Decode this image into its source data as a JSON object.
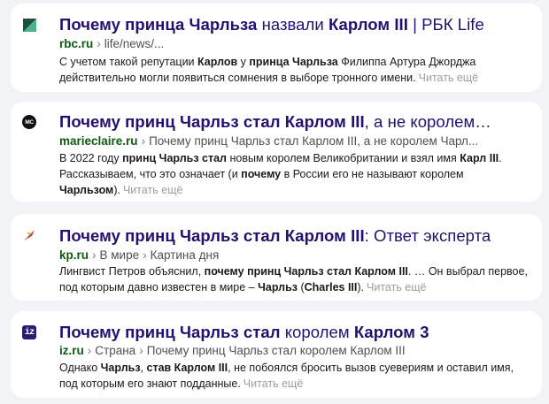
{
  "results": [
    {
      "favicon": "rbc-favicon-icon",
      "title_parts": [
        {
          "text": "Почему принца Чарльза",
          "bold": true
        },
        {
          "text": " назвали ",
          "bold": false
        },
        {
          "text": "Карлом III",
          "bold": true
        },
        {
          "text": " | РБК Life",
          "bold": false
        }
      ],
      "host": "rbc.ru",
      "crumbs": [
        "life/news/..."
      ],
      "snippet_parts": [
        {
          "text": "С учетом такой репутации ",
          "bold": false
        },
        {
          "text": "Карлов",
          "bold": true
        },
        {
          "text": " у ",
          "bold": false
        },
        {
          "text": "принца Чарльза",
          "bold": true
        },
        {
          "text": " Филиппа Артура Джорджа действительно могли появиться сомнения в выборе тронного имени.",
          "bold": false
        }
      ],
      "read_more": "Читать ещё"
    },
    {
      "favicon": "marieclaire-favicon-icon",
      "favicon_text": "MC",
      "title_parts": [
        {
          "text": "Почему принц Чарльз стал Карлом III",
          "bold": true
        },
        {
          "text": ", а не королем…",
          "bold": false
        }
      ],
      "host": "marieclaire.ru",
      "crumbs": [
        "Почему принц Чарльз стал Карлом III, а не королем Чарл..."
      ],
      "snippet_parts": [
        {
          "text": "В 2022 году ",
          "bold": false
        },
        {
          "text": "принц Чарльз стал",
          "bold": true
        },
        {
          "text": " новым королем Великобритании и взял имя ",
          "bold": false
        },
        {
          "text": "Карл III",
          "bold": true
        },
        {
          "text": ". Рассказываем, что это означает (и ",
          "bold": false
        },
        {
          "text": "почему",
          "bold": true
        },
        {
          "text": " в России его не называют королем ",
          "bold": false
        },
        {
          "text": "Чарльзом",
          "bold": true
        },
        {
          "text": ").",
          "bold": false
        }
      ],
      "read_more": "Читать ещё"
    },
    {
      "favicon": "kp-favicon-icon",
      "title_parts": [
        {
          "text": "Почему принц Чарльз стал Карлом III",
          "bold": true
        },
        {
          "text": ": Ответ эксперта",
          "bold": false
        }
      ],
      "host": "kp.ru",
      "crumbs": [
        "В мире",
        "Картина дня"
      ],
      "snippet_parts": [
        {
          "text": "Лингвист Петров объяснил, ",
          "bold": false
        },
        {
          "text": "почему принц Чарльз стал Карлом III",
          "bold": true
        },
        {
          "text": ". … Он выбрал первое, под которым давно известен в мире – ",
          "bold": false
        },
        {
          "text": "Чарльз",
          "bold": true
        },
        {
          "text": " (",
          "bold": false
        },
        {
          "text": "Charles III",
          "bold": true
        },
        {
          "text": ").",
          "bold": false
        }
      ],
      "read_more": "Читать ещё"
    },
    {
      "favicon": "izvestia-favicon-icon",
      "favicon_text": "iz",
      "title_parts": [
        {
          "text": "Почему принц Чарльз стал",
          "bold": true
        },
        {
          "text": " королем ",
          "bold": false
        },
        {
          "text": "Карлом 3",
          "bold": true
        }
      ],
      "host": "iz.ru",
      "crumbs": [
        "Страна",
        "Почему принц Чарльз стал королем Карлом III"
      ],
      "snippet_parts": [
        {
          "text": "Однако ",
          "bold": false
        },
        {
          "text": "Чарльз",
          "bold": true
        },
        {
          "text": ", ",
          "bold": false
        },
        {
          "text": "став Карлом III",
          "bold": true
        },
        {
          "text": ", не побоялся бросить вызов суевериям и оставил имя, под которым его знают подданные.",
          "bold": false
        }
      ],
      "read_more": "Читать ещё"
    }
  ]
}
